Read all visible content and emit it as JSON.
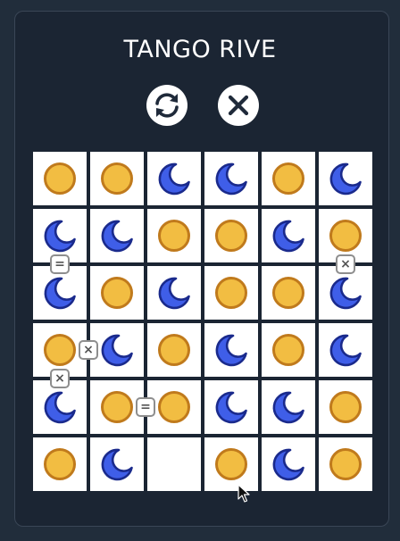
{
  "app": {
    "title": "TANGO RIVE"
  },
  "controls": [
    {
      "name": "restart-button",
      "icon": "refresh-icon"
    },
    {
      "name": "close-button",
      "icon": "close-icon"
    }
  ],
  "colors": {
    "background": "#212d3b",
    "panel": "#1b2533",
    "sun_fill": "#f2bd42",
    "sun_stroke": "#c07a1c",
    "moon_fill": "#3f5ee8",
    "moon_stroke": "#1a2a8c",
    "constraint_border": "#8e8e8e"
  },
  "board": {
    "rows": 6,
    "cols": 6,
    "grid": [
      [
        "sun",
        "sun",
        "moon",
        "moon",
        "sun",
        "moon"
      ],
      [
        "moon",
        "moon",
        "sun",
        "sun",
        "moon",
        "sun"
      ],
      [
        "moon",
        "sun",
        "moon",
        "sun",
        "sun",
        "moon"
      ],
      [
        "sun",
        "moon",
        "sun",
        "moon",
        "sun",
        "moon"
      ],
      [
        "moon",
        "sun",
        "sun",
        "moon",
        "moon",
        "sun"
      ],
      [
        "sun",
        "moon",
        "empty",
        "sun",
        "moon",
        "sun"
      ]
    ],
    "constraints": [
      {
        "type": "equal",
        "label": "=",
        "between": [
          [
            1,
            0
          ],
          [
            2,
            0
          ]
        ]
      },
      {
        "type": "opposite",
        "label": "×",
        "between": [
          [
            1,
            5
          ],
          [
            2,
            5
          ]
        ]
      },
      {
        "type": "opposite",
        "label": "×",
        "between": [
          [
            3,
            0
          ],
          [
            3,
            1
          ]
        ]
      },
      {
        "type": "opposite",
        "label": "×",
        "between": [
          [
            3,
            0
          ],
          [
            4,
            0
          ]
        ]
      },
      {
        "type": "equal",
        "label": "=",
        "between": [
          [
            4,
            1
          ],
          [
            4,
            2
          ]
        ]
      }
    ]
  }
}
